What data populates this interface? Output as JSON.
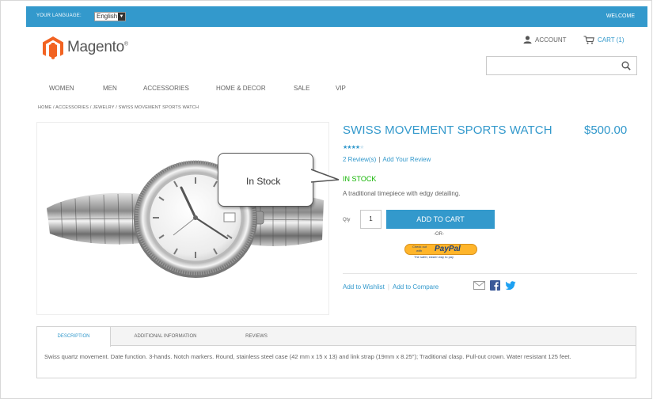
{
  "header": {
    "language_label": "YOUR LANGUAGE:",
    "language_value": "English",
    "welcome": "WELCOME",
    "logo_text": "Magento",
    "logo_mark": "®",
    "account_label": "ACCOUNT",
    "cart_label": "CART (1)"
  },
  "nav": {
    "items": [
      "WOMEN",
      "MEN",
      "ACCESSORIES",
      "HOME & DECOR",
      "SALE",
      "VIP"
    ]
  },
  "breadcrumb": "HOME / ACCESSORIES / JEWELRY / SWISS MOVEMENT SPORTS WATCH",
  "callout": {
    "text": "In Stock"
  },
  "product": {
    "name": "SWISS MOVEMENT SPORTS WATCH",
    "price": "$500.00",
    "rating_stars": 4,
    "rating_max": 5,
    "reviews_link": "2 Review(s)",
    "add_review_link": "Add Your Review",
    "review_separator": "|",
    "stock": "IN STOCK",
    "short_description": "A traditional timepiece with edgy detailing.",
    "qty_label": "Qty",
    "qty_value": "1",
    "add_to_cart": "ADD TO CART",
    "or_text": "-OR-",
    "paypal": {
      "line1": "Check out",
      "line2": "with",
      "brand": "PayPal",
      "tagline": "The safer, easier way to pay"
    },
    "wishlist_link": "Add to Wishlist",
    "compare_link": "Add to Compare",
    "link_separator": "|"
  },
  "tabs": {
    "items": [
      "DESCRIPTION",
      "ADDITIONAL INFORMATION",
      "REVIEWS"
    ],
    "active_index": 0,
    "description": "Swiss quartz movement. Date function. 3-hands. Notch markers. Round, stainless steel case (42 mm x 15 x 13) and link strap (19mm x 8.25\"); Traditional clasp. Pull-out crown. Water resistant 125 feet."
  },
  "colors": {
    "accent": "#3399cc",
    "in_stock": "#11b400",
    "text": "#636363",
    "paypal_orange": "#ffb52b",
    "facebook": "#3b5998",
    "twitter": "#1da1f2"
  },
  "icons": {
    "logo": "magento-logo-icon",
    "account": "user-icon",
    "cart": "cart-icon",
    "search": "search-icon",
    "email": "email-icon",
    "facebook": "facebook-icon",
    "twitter": "twitter-icon",
    "language_dropdown": "chevron-down-icon"
  }
}
